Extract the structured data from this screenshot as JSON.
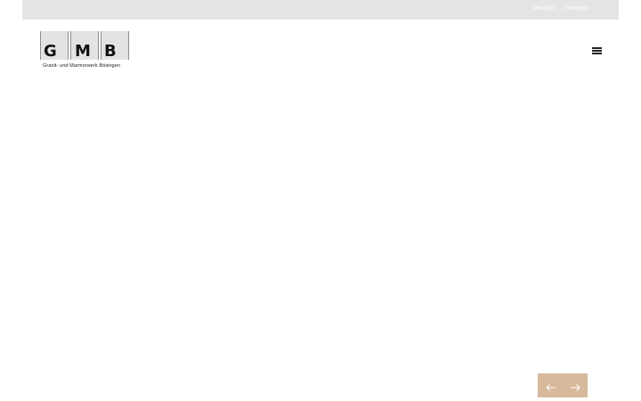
{
  "header": {
    "languages": [
      {
        "label": "Deutsch"
      },
      {
        "label": "Français"
      }
    ]
  },
  "logo": {
    "letters": [
      "G",
      "M",
      "B"
    ],
    "tagline": "Granit- und Marmorwerk Bösingen"
  },
  "menu": {
    "icon": "hamburger-menu-icon"
  },
  "slider": {
    "prev_icon": "arrow-left-icon",
    "next_icon": "arrow-right-icon"
  },
  "colors": {
    "topbar": "#e4e4e4",
    "accent": "#d7b99c",
    "logo_tile": "#e3e3e3"
  }
}
